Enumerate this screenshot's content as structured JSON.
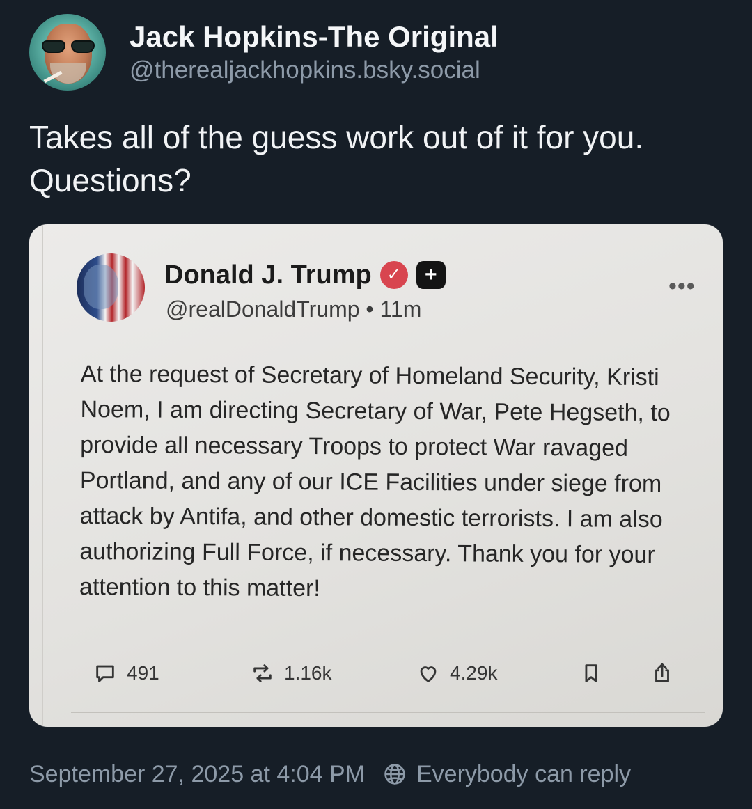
{
  "post": {
    "author": {
      "display_name": "Jack Hopkins-The Original",
      "handle": "@therealjackhopkins.bsky.social"
    },
    "text": "Takes all of the guess work out of it for you. Questions?",
    "footer": {
      "timestamp": "September 27, 2025 at 4:04 PM",
      "reply_setting": "Everybody can reply"
    }
  },
  "embed": {
    "author": {
      "display_name": "Donald J. Trump",
      "handle_time": "@realDonaldTrump • 11m",
      "more": "•••"
    },
    "body": "At the request of Secretary of Homeland Security, Kristi Noem, I am directing Secretary of War, Pete Hegseth, to provide all necessary Troops to protect War ravaged Portland, and any of our ICE Facilities under siege from attack by Antifa, and other domestic terrorists. I am also authorizing Full Force, if necessary. Thank you for your attention to this matter!",
    "actions": {
      "replies": "491",
      "reposts": "1.16k",
      "likes": "4.29k"
    }
  },
  "icons": {
    "reply": "speech-bubble-icon",
    "repost": "repost-arrows-icon",
    "like": "heart-icon",
    "bookmark": "bookmark-icon",
    "share": "share-icon",
    "verified": "verified-badge-icon",
    "plus": "plus-badge-icon",
    "reply_setting": "globe-icon"
  },
  "colors": {
    "background": "#161e27",
    "secondary_text": "#8d9aa8",
    "verified_badge": "#d8454f"
  }
}
